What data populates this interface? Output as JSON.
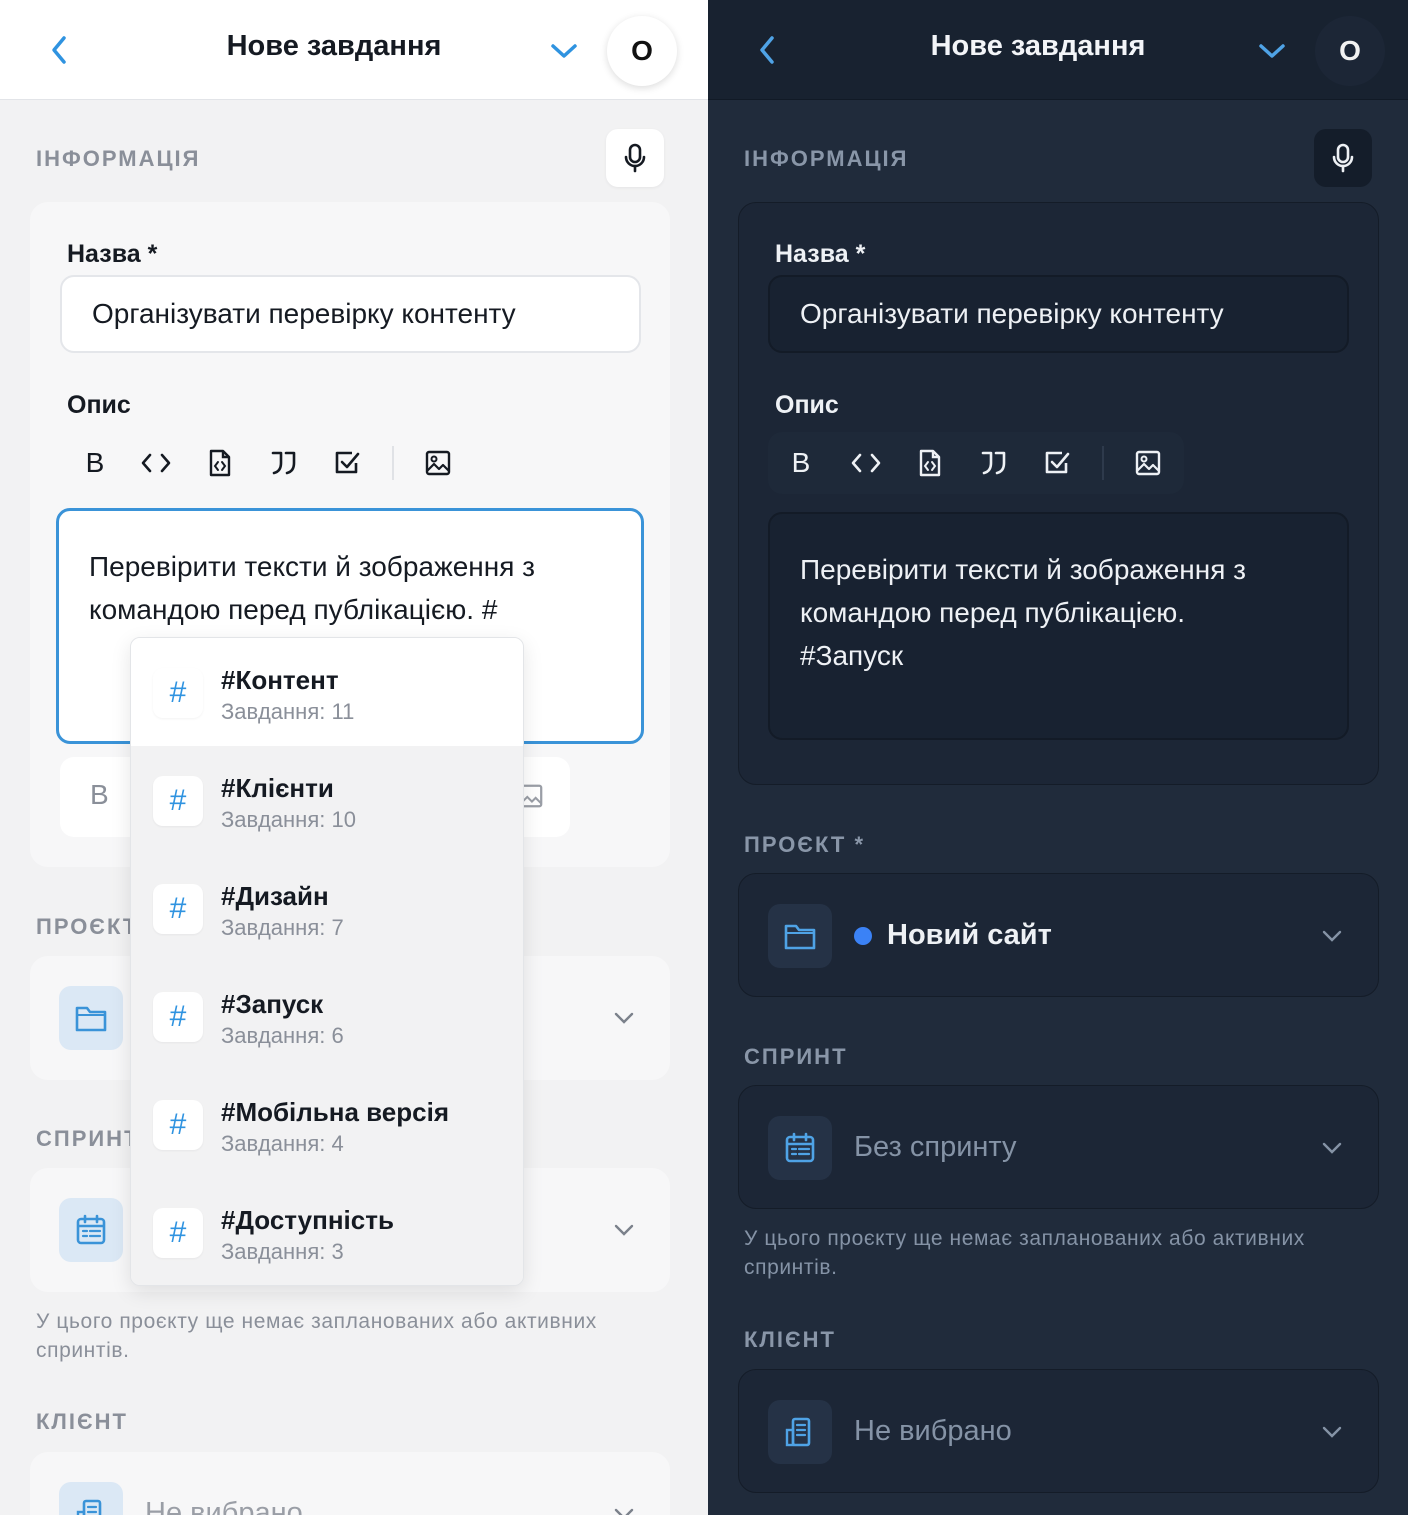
{
  "header": {
    "title": "Нове завдання",
    "avatar_initial": "O"
  },
  "info": {
    "section_label": "ІНФОРМАЦІЯ",
    "name_label": "Назва *",
    "name_value": "Організувати перевірку контенту",
    "description_label": "Опис"
  },
  "toolbar": {
    "bold_label": "B"
  },
  "light": {
    "description_line1": "Перевірити тексти й зображення з",
    "description_line2": "командою перед публікацією. #",
    "project_label": "ПРОЄКТ",
    "sprint_label": "СПРИНТ",
    "sprint_note": "У цього проєкту ще немає запланованих або активних спринтів.",
    "client_label": "КЛІЄНТ",
    "client_value": "Не вибрано"
  },
  "dark": {
    "description_line1": "Перевірити тексти й зображення з",
    "description_line2": "командою перед публікацією.",
    "description_line3": "#Запуск",
    "project_label": "ПРОЄКТ *",
    "project_value": "Новий сайт",
    "sprint_label": "СПРИНТ",
    "sprint_value": "Без спринту",
    "sprint_note": "У цього проєкту ще немає запланованих або активних спринтів.",
    "client_label": "КЛІЄНТ",
    "client_value": "Не вибрано"
  },
  "hashtag_suggestions": [
    {
      "name": "#Контент",
      "count": "Завдання: 11"
    },
    {
      "name": "#Клієнти",
      "count": "Завдання: 10"
    },
    {
      "name": "#Дизайн",
      "count": "Завдання: 7"
    },
    {
      "name": "#Запуск",
      "count": "Завдання: 6"
    },
    {
      "name": "#Мобільна версія",
      "count": "Завдання: 4"
    },
    {
      "name": "#Доступність",
      "count": "Завдання: 3"
    }
  ],
  "colors": {
    "accent": "#2f93e0",
    "project_dot": "#3b82f6",
    "light_bg": "#f2f2f3",
    "dark_bg": "#202b3b"
  }
}
